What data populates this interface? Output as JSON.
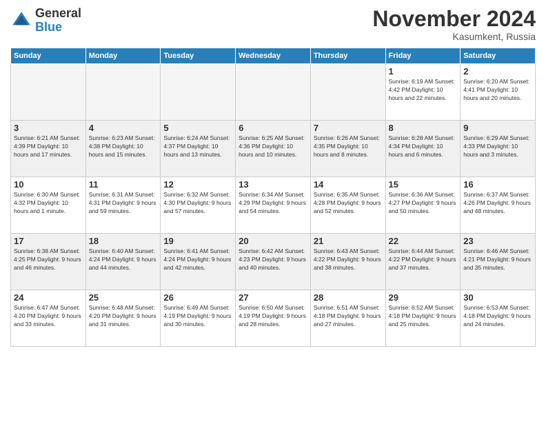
{
  "logo": {
    "general": "General",
    "blue": "Blue"
  },
  "header": {
    "title": "November 2024",
    "location": "Kasumkent, Russia"
  },
  "days_of_week": [
    "Sunday",
    "Monday",
    "Tuesday",
    "Wednesday",
    "Thursday",
    "Friday",
    "Saturday"
  ],
  "weeks": [
    [
      {
        "day": "",
        "info": ""
      },
      {
        "day": "",
        "info": ""
      },
      {
        "day": "",
        "info": ""
      },
      {
        "day": "",
        "info": ""
      },
      {
        "day": "",
        "info": ""
      },
      {
        "day": "1",
        "info": "Sunrise: 6:19 AM\nSunset: 4:42 PM\nDaylight: 10 hours and 22 minutes."
      },
      {
        "day": "2",
        "info": "Sunrise: 6:20 AM\nSunset: 4:41 PM\nDaylight: 10 hours and 20 minutes."
      }
    ],
    [
      {
        "day": "3",
        "info": "Sunrise: 6:21 AM\nSunset: 4:39 PM\nDaylight: 10 hours and 17 minutes."
      },
      {
        "day": "4",
        "info": "Sunrise: 6:23 AM\nSunset: 4:38 PM\nDaylight: 10 hours and 15 minutes."
      },
      {
        "day": "5",
        "info": "Sunrise: 6:24 AM\nSunset: 4:37 PM\nDaylight: 10 hours and 13 minutes."
      },
      {
        "day": "6",
        "info": "Sunrise: 6:25 AM\nSunset: 4:36 PM\nDaylight: 10 hours and 10 minutes."
      },
      {
        "day": "7",
        "info": "Sunrise: 6:26 AM\nSunset: 4:35 PM\nDaylight: 10 hours and 8 minutes."
      },
      {
        "day": "8",
        "info": "Sunrise: 6:28 AM\nSunset: 4:34 PM\nDaylight: 10 hours and 6 minutes."
      },
      {
        "day": "9",
        "info": "Sunrise: 6:29 AM\nSunset: 4:33 PM\nDaylight: 10 hours and 3 minutes."
      }
    ],
    [
      {
        "day": "10",
        "info": "Sunrise: 6:30 AM\nSunset: 4:32 PM\nDaylight: 10 hours and 1 minute."
      },
      {
        "day": "11",
        "info": "Sunrise: 6:31 AM\nSunset: 4:31 PM\nDaylight: 9 hours and 59 minutes."
      },
      {
        "day": "12",
        "info": "Sunrise: 6:32 AM\nSunset: 4:30 PM\nDaylight: 9 hours and 57 minutes."
      },
      {
        "day": "13",
        "info": "Sunrise: 6:34 AM\nSunset: 4:29 PM\nDaylight: 9 hours and 54 minutes."
      },
      {
        "day": "14",
        "info": "Sunrise: 6:35 AM\nSunset: 4:28 PM\nDaylight: 9 hours and 52 minutes."
      },
      {
        "day": "15",
        "info": "Sunrise: 6:36 AM\nSunset: 4:27 PM\nDaylight: 9 hours and 50 minutes."
      },
      {
        "day": "16",
        "info": "Sunrise: 6:37 AM\nSunset: 4:26 PM\nDaylight: 9 hours and 48 minutes."
      }
    ],
    [
      {
        "day": "17",
        "info": "Sunrise: 6:38 AM\nSunset: 4:25 PM\nDaylight: 9 hours and 46 minutes."
      },
      {
        "day": "18",
        "info": "Sunrise: 6:40 AM\nSunset: 4:24 PM\nDaylight: 9 hours and 44 minutes."
      },
      {
        "day": "19",
        "info": "Sunrise: 6:41 AM\nSunset: 4:24 PM\nDaylight: 9 hours and 42 minutes."
      },
      {
        "day": "20",
        "info": "Sunrise: 6:42 AM\nSunset: 4:23 PM\nDaylight: 9 hours and 40 minutes."
      },
      {
        "day": "21",
        "info": "Sunrise: 6:43 AM\nSunset: 4:22 PM\nDaylight: 9 hours and 38 minutes."
      },
      {
        "day": "22",
        "info": "Sunrise: 6:44 AM\nSunset: 4:22 PM\nDaylight: 9 hours and 37 minutes."
      },
      {
        "day": "23",
        "info": "Sunrise: 6:46 AM\nSunset: 4:21 PM\nDaylight: 9 hours and 35 minutes."
      }
    ],
    [
      {
        "day": "24",
        "info": "Sunrise: 6:47 AM\nSunset: 4:20 PM\nDaylight: 9 hours and 33 minutes."
      },
      {
        "day": "25",
        "info": "Sunrise: 6:48 AM\nSunset: 4:20 PM\nDaylight: 9 hours and 31 minutes."
      },
      {
        "day": "26",
        "info": "Sunrise: 6:49 AM\nSunset: 4:19 PM\nDaylight: 9 hours and 30 minutes."
      },
      {
        "day": "27",
        "info": "Sunrise: 6:50 AM\nSunset: 4:19 PM\nDaylight: 9 hours and 28 minutes."
      },
      {
        "day": "28",
        "info": "Sunrise: 6:51 AM\nSunset: 4:18 PM\nDaylight: 9 hours and 27 minutes."
      },
      {
        "day": "29",
        "info": "Sunrise: 6:52 AM\nSunset: 4:18 PM\nDaylight: 9 hours and 25 minutes."
      },
      {
        "day": "30",
        "info": "Sunrise: 6:53 AM\nSunset: 4:18 PM\nDaylight: 9 hours and 24 minutes."
      }
    ]
  ]
}
